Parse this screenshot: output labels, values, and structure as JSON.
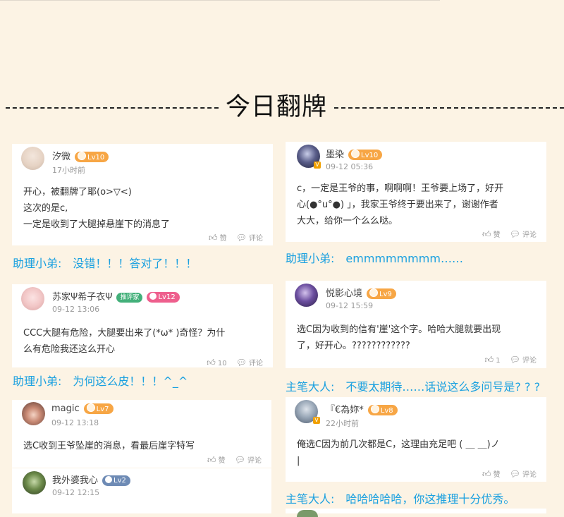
{
  "heading": "今日翻牌",
  "comments": [
    {
      "name": "汐微",
      "level": "Lv10",
      "time": "17小时前",
      "lines": [
        "开心，被翻牌了耶(o>▽<)",
        "这次的是c,",
        "一定是收到了大腿掉悬崖下的消息了"
      ],
      "like": "赞",
      "comment": "评论"
    },
    {
      "name": "墨染",
      "level": "Lv10",
      "time": "09-12 05:36",
      "lines": [
        "c，一定是王爷的事，啊啊啊！王爷要上场了，好开",
        "心(●°u°●) 」，我家王爷终于要出来了，谢谢作者",
        "大大，给你一个么么哒。"
      ],
      "like": "赞",
      "comment": "评论"
    },
    {
      "name": "苏家Ψ希子衣Ψ",
      "tag": "推评家",
      "level": "Lv12",
      "time": "09-12 13:06",
      "lines": [
        "CCC大腿有危险，大腿要出来了(*ω* )奇怪？为什",
        "么有危险我还这么开心"
      ],
      "like": "10",
      "comment": "评论"
    },
    {
      "name": "悦影心境",
      "level": "Lv9",
      "time": "09-12 15:59",
      "lines": [
        "选C因为收到的信有'崖'这个字。哈哈大腿就要出现",
        "了，好开心。????????????"
      ],
      "like": "1",
      "comment": "评论"
    },
    {
      "name": "magic",
      "level": "Lv7",
      "time": "09-12 13:18",
      "lines": [
        "选C收到王爷坠崖的消息，看最后崖字特写"
      ],
      "like": "赞",
      "comment": "评论"
    },
    {
      "name": "『€為妳*",
      "level": "Lv8",
      "time": "22小时前",
      "lines": [
        "俺选C因为前几次都是C，这理由充足吧 ( ＿ ＿)ノ",
        "|"
      ],
      "like": "赞",
      "comment": "评论"
    },
    {
      "name": "我外婆我心",
      "level": "Lv2",
      "time": "09-12 12:15",
      "lines": [],
      "like": "",
      "comment": ""
    }
  ],
  "replies": [
    {
      "who": "助理小弟:",
      "text": "没错！！！答对了！！！"
    },
    {
      "who": "助理小弟:",
      "text": "emmmmmmmm……"
    },
    {
      "who": "助理小弟:",
      "text": "为何这么皮！！！^_^"
    },
    {
      "who": "主笔大人:",
      "text": "不要太期待……话说这么多问号是? ? ?"
    },
    {
      "who": "主笔大人:",
      "text": "哈哈哈哈哈，你这推理十分优秀。"
    }
  ],
  "colors": {
    "accent": "#1aa0e0",
    "background": "#fcf3e4",
    "lv_orange": "#f7a645",
    "lv_pink": "#ee5f8d",
    "lv_blue": "#6e8bb5"
  },
  "icons": {
    "like": "thumbs-up-icon",
    "comment": "speech-bubble-icon"
  }
}
